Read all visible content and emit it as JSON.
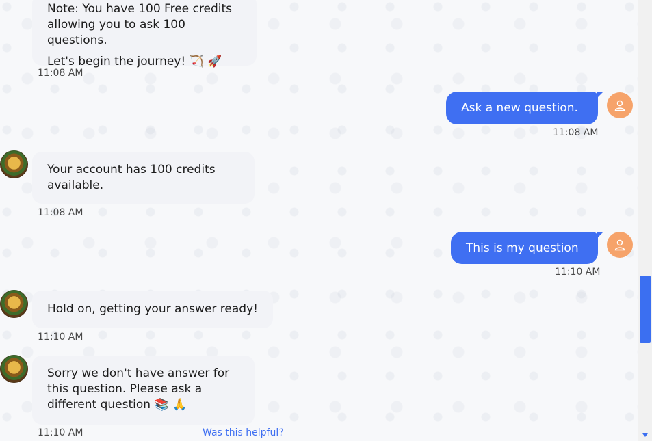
{
  "messages": {
    "m1": {
      "line1": "Note: You have 100 Free credits",
      "line2": "allowing you to ask 100 questions.",
      "line3": "Let's begin the journey! 🏹 🚀",
      "time": "11:08 AM"
    },
    "u1": {
      "text": "Ask a new question.",
      "time": "11:08 AM"
    },
    "m2": {
      "text": "Your account has 100 credits available.",
      "time": "11:08 AM"
    },
    "u2": {
      "text": "This is my question",
      "time": "11:10 AM"
    },
    "m3": {
      "text": "Hold on, getting your answer ready!",
      "time": "11:10 AM"
    },
    "m4": {
      "text": "Sorry we don't have answer for this question. Please ask a different question 📚 🙏",
      "time": "11:10 AM",
      "feedback_link": "Was this helpful?"
    }
  },
  "colors": {
    "user_bubble": "#3f6ff2",
    "bot_bubble": "#f2f3f7",
    "user_avatar": "#f6a36a",
    "scrollbar_thumb": "#3b6ff1"
  },
  "icons": {
    "bot_avatar": "bot-avatar-icon",
    "user_avatar": "user-icon"
  }
}
